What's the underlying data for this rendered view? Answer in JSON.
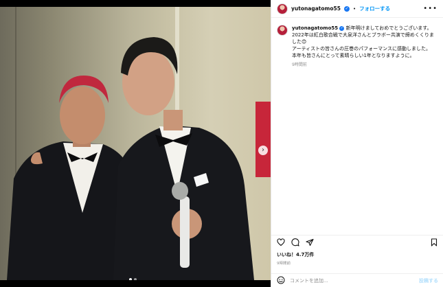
{
  "post": {
    "username": "yutonagatomo55",
    "verified_icon": "verified-badge-icon",
    "follow_label": "フォローする",
    "separator": "•",
    "more_label": "•••",
    "caption_lines": [
      "新年明けましておめでとうございます。",
      "2022年は紅白歌合戦で大泉洋さんとブラボー共演で締めくくりました😊",
      "アーティストの皆さんの圧巻のパフォーマンスに感動しました。",
      "本年も皆さんにとって素晴らしい1年となりますように。"
    ],
    "caption_time": "9時間前",
    "likes": "いいね！4.7万件",
    "post_time": "9時間前",
    "comment_placeholder": "コメントを追加...",
    "post_label": "投稿する"
  },
  "photo": {
    "banner_arrow": "›",
    "carousel_count": 2,
    "carousel_active": 0
  },
  "colors": {
    "accent": "#0095f6",
    "verified": "#1877f2",
    "banner": "#c7263a"
  },
  "icons": [
    "heart-icon",
    "comment-icon",
    "share-icon",
    "bookmark-icon",
    "emoji-icon",
    "more-icon"
  ]
}
